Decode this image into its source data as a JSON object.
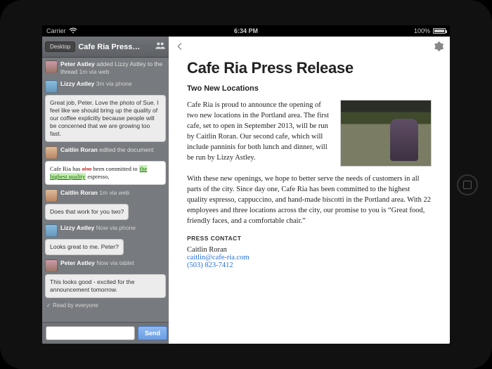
{
  "status": {
    "carrier": "Carrier",
    "time": "6:34 PM",
    "battery": "100%"
  },
  "sidebar": {
    "desktop_label": "Desktop",
    "title": "Cafe Ria Press…"
  },
  "thread": [
    {
      "user": "Peter Astley",
      "action": "added Lizzy Astley to the thread",
      "ago": "1m via web",
      "bubble": null
    },
    {
      "user": "Lizzy Astley",
      "ago": "3m via phone",
      "bubble": "Great job, Peter. Love the photo of Sue. I feel like we should bring up the quality of our coffee explicitly because people will be concerned that we are growing too fast."
    },
    {
      "user": "Caitlin Roran",
      "action": "edited the document",
      "diff_pre": "Cafe Ria has ",
      "diff_strike": "also",
      "diff_mid": " been committed to ",
      "diff_hl": "the highest quality",
      "diff_post": " espresso,"
    },
    {
      "user": "Caitlin Roran",
      "ago": "1m via web",
      "bubble": "Does that work for you two?"
    },
    {
      "user": "Lizzy Astley",
      "ago": "Now via phone",
      "bubble": "Looks great to me. Peter?"
    },
    {
      "user": "Peter Astley",
      "ago": "Now via tablet",
      "bubble": "This looks good - excited for the announcement tomorrow."
    }
  ],
  "read_by": "Read by everyone",
  "send_label": "Send",
  "doc": {
    "title": "Cafe Ria Press Release",
    "subtitle": "Two New Locations",
    "p1": "Cafe Ria is proud to announce the opening of two new locations in the Portland area. The first cafe, set to open in September 2013, will be run by Caitlin Roran. Our second cafe, which will include panninis for both lunch and dinner, will be run by Lizzy Astley.",
    "p2": "With these new openings, we hope to better serve the needs of customers in all parts of the city. Since day one, Cafe Ria has been committed to the highest quality espresso, cappuccino, and hand-made biscotti in the Portland area. With 22 employees and three locations across the city, our promise to you is “Great food, friendly faces, and a comfortable chair.”",
    "contact_label": "PRESS CONTACT",
    "contact_name": "Caitlin Roran",
    "contact_email": "caitlin@cafe-ria.com",
    "contact_phone": "(503) 823-7412"
  }
}
